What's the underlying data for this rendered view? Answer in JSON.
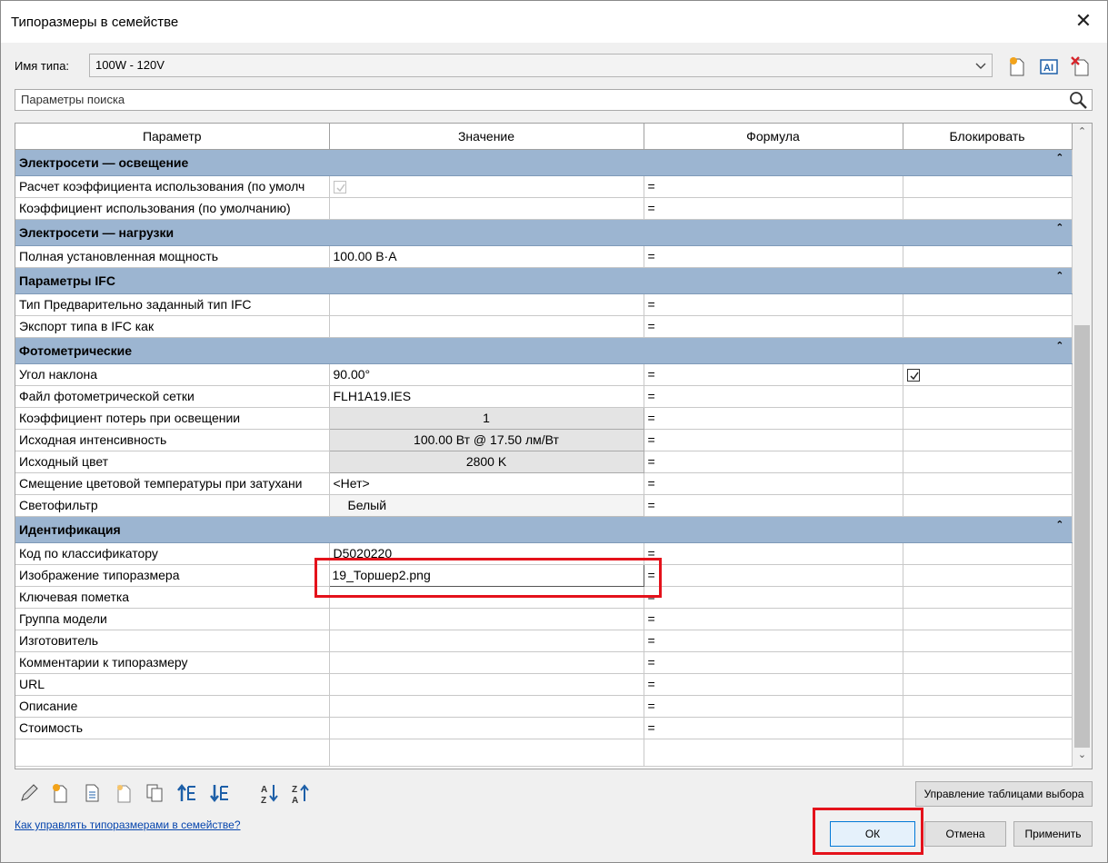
{
  "window": {
    "title": "Типоразмеры в семействе"
  },
  "type_row": {
    "label": "Имя типа:",
    "value": "100W - 120V"
  },
  "search": {
    "placeholder": "Параметры поиска"
  },
  "columns": [
    "Параметр",
    "Значение",
    "Формула",
    "Блокировать"
  ],
  "groups": [
    {
      "name": "Электросети — освещение",
      "rows": [
        {
          "param": "Расчет коэффициента использования (по умолч",
          "value": "",
          "formula": "=",
          "checkbox_value": "checked-disabled"
        },
        {
          "param": "Коэффициент использования (по умолчанию)",
          "value": "",
          "formula": "="
        }
      ]
    },
    {
      "name": "Электросети — нагрузки",
      "rows": [
        {
          "param": "Полная установленная мощность",
          "value": "100.00 В·А",
          "formula": "="
        }
      ]
    },
    {
      "name": "Параметры IFC",
      "rows": [
        {
          "param": "Тип Предварительно заданный тип IFC",
          "value": "",
          "formula": "="
        },
        {
          "param": "Экспорт типа в IFC как",
          "value": "",
          "formula": "="
        }
      ]
    },
    {
      "name": "Фотометрические",
      "rows": [
        {
          "param": "Угол наклона",
          "value": "90.00°",
          "formula": "=",
          "lock_checked": true
        },
        {
          "param": "Файл фотометрической сетки",
          "value": "FLH1A19.IES",
          "formula": "="
        },
        {
          "param": "Коэффициент потерь при освещении",
          "value": "1",
          "formula": "=",
          "style": "button"
        },
        {
          "param": "Исходная интенсивность",
          "value": "100.00 Вт @ 17.50 лм/Вт",
          "formula": "=",
          "style": "button"
        },
        {
          "param": "Исходный цвет",
          "value": "2800 K",
          "formula": "=",
          "style": "button"
        },
        {
          "param": "Смещение цветовой температуры при затухани",
          "value": "<Нет>",
          "formula": "="
        },
        {
          "param": "Светофильтр",
          "value": "Белый",
          "formula": "=",
          "style": "swatch"
        }
      ]
    },
    {
      "name": "Идентификация",
      "rows": [
        {
          "param": "Код по классификатору",
          "value": "D5020220",
          "formula": "="
        },
        {
          "param": "Изображение типоразмера",
          "value": "19_Торшер2.png",
          "formula": "=",
          "style": "editing"
        },
        {
          "param": "Ключевая пометка",
          "value": "",
          "formula": "="
        },
        {
          "param": "Группа модели",
          "value": "",
          "formula": "="
        },
        {
          "param": "Изготовитель",
          "value": "",
          "formula": "="
        },
        {
          "param": "Комментарии к типоразмеру",
          "value": "",
          "formula": "="
        },
        {
          "param": "URL",
          "value": "",
          "formula": "="
        },
        {
          "param": "Описание",
          "value": "",
          "formula": "="
        },
        {
          "param": "Стоимость",
          "value": "",
          "formula": "="
        }
      ]
    }
  ],
  "footer": {
    "help_link": "Как управлять типоразмерами в семействе?",
    "lookup_button": "Управление таблицами выбора",
    "ok": "ОК",
    "cancel": "Отмена",
    "apply": "Применить"
  },
  "colors": {
    "group_header": "#9cb5d1",
    "highlight": "#e4121b",
    "accent": "#0078d7"
  }
}
